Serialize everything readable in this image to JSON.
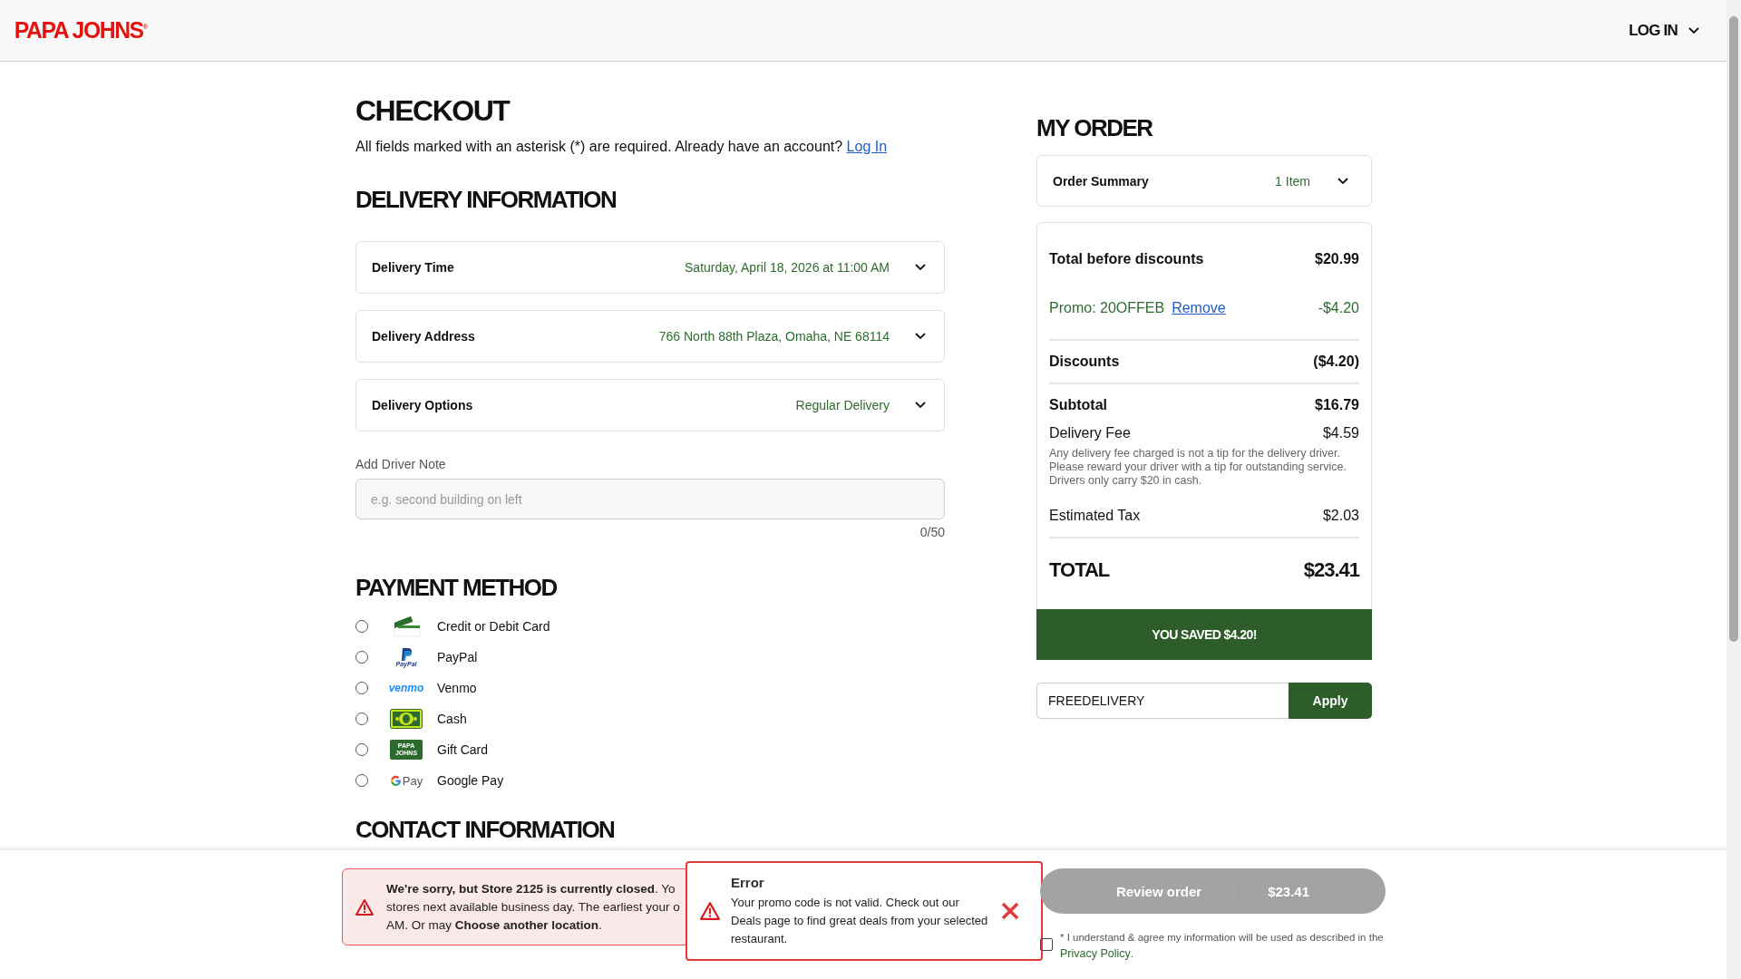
{
  "header": {
    "logo": "PAPA JOHNS",
    "logo_mark": "®",
    "login": "LOG IN"
  },
  "checkout": {
    "title": "CHECKOUT",
    "note": "All fields marked with an asterisk (*) are required. Already have an account?",
    "login_link": "Log In"
  },
  "delivery": {
    "title": "DELIVERY INFORMATION",
    "rows": [
      {
        "label": "Delivery Time",
        "value": "Saturday, April 18, 2026 at 11:00 AM",
        "expanded": false
      },
      {
        "label": "Delivery Address",
        "value": "766 North 88th Plaza, Omaha, NE 68114",
        "expanded": false
      },
      {
        "label": "Delivery Options",
        "value": "Regular Delivery",
        "expanded": false
      }
    ],
    "driver_note": {
      "label": "Add Driver Note",
      "placeholder": "e.g. second building on left",
      "count": "0/50"
    }
  },
  "payment": {
    "title": "PAYMENT METHOD",
    "methods": [
      {
        "kind": "card",
        "label": "Credit or Debit Card",
        "selected": false
      },
      {
        "kind": "paypal",
        "logo": "PayPal",
        "label": "PayPal",
        "selected": false
      },
      {
        "kind": "venmo",
        "logo": "venmo",
        "label": "Venmo",
        "selected": false
      },
      {
        "kind": "cash",
        "label": "Cash",
        "selected": false
      },
      {
        "kind": "gift",
        "logo": "PAPA JOHNS",
        "label": "Gift Card",
        "selected": false
      },
      {
        "kind": "gpay",
        "logo": "Pay",
        "label": "Google Pay",
        "selected": false
      }
    ]
  },
  "contact": {
    "title": "CONTACT INFORMATION"
  },
  "order": {
    "title": "MY ORDER",
    "summary": {
      "label": "Order Summary",
      "count": "1 Item",
      "expanded": false
    },
    "lines": [
      {
        "kind": "strong",
        "label": "Total before discounts",
        "amount": "$20.99",
        "rule": false
      },
      {
        "kind": "promo",
        "label": "Promo: 20OFFEB",
        "link": "Remove",
        "amount": "-$4.20",
        "rule": true
      },
      {
        "kind": "strong",
        "label": "Discounts",
        "amount": "($4.20)",
        "rule": true
      },
      {
        "kind": "strong",
        "label": "Subtotal",
        "amount": "$16.79",
        "rule": false
      },
      {
        "kind": "plain",
        "label": "Delivery Fee",
        "amount": "$4.59",
        "note": "Any delivery fee charged is not a tip for the delivery driver. Please reward your driver with a tip for outstanding service. Drivers only carry $20 in cash.",
        "rule": false
      },
      {
        "kind": "plain",
        "label": "Estimated Tax",
        "amount": "$2.03",
        "rule": true
      },
      {
        "kind": "grand",
        "label": "TOTAL",
        "amount": "$23.41",
        "rule": false
      }
    ],
    "saved": "YOU SAVED $4.20!",
    "promo": {
      "value": "FREEDELIVERY",
      "button": "Apply"
    }
  },
  "footer": {
    "closed_alert": [
      "**We're sorry, but Store 2125 is currently closed**. Yo",
      "stores next available business day. The earliest your o",
      "AM. Or may **Choose another location**."
    ],
    "error": {
      "title": "Error",
      "message": "Your promo code is not valid. Check out our Deals page to find great deals from your selected restaurant."
    },
    "review": {
      "label": "Review order",
      "total": "$23.41",
      "disabled": true
    },
    "consent": {
      "text": "* I understand & agree my information will be used as described in the",
      "link": "Privacy Policy",
      "end": ".",
      "checked": false
    }
  }
}
